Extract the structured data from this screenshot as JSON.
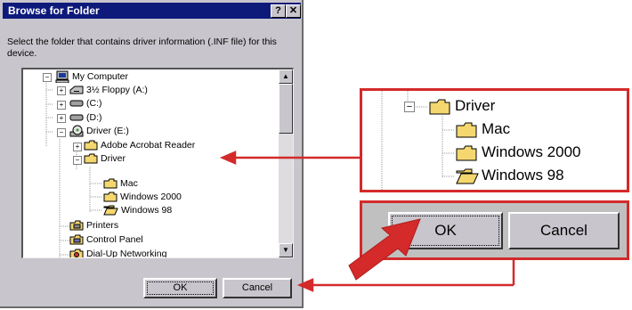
{
  "dialog": {
    "title": "Browse for Folder",
    "help_button": "?",
    "close_button": "✕",
    "instruction": "Select the folder that contains driver information (.INF file) for this device.",
    "tree": [
      {
        "label": "My Computer",
        "icon": "computer-icon",
        "expander": "−"
      },
      {
        "label": "3½ Floppy (A:)",
        "icon": "floppy-drive-icon",
        "expander": "+"
      },
      {
        "label": "(C:)",
        "icon": "hard-drive-icon",
        "expander": "+"
      },
      {
        "label": "(D:)",
        "icon": "hard-drive-icon",
        "expander": "+"
      },
      {
        "label": "Driver (E:)",
        "icon": "cd-drive-icon",
        "expander": "−"
      },
      {
        "label": "Adobe Acrobat Reader",
        "icon": "folder-icon",
        "expander": "+"
      },
      {
        "label": "Driver",
        "icon": "folder-icon",
        "expander": "−"
      },
      {
        "label": "Mac",
        "icon": "folder-icon"
      },
      {
        "label": "Windows 2000",
        "icon": "folder-icon"
      },
      {
        "label": "Windows 98",
        "icon": "open-folder-icon"
      },
      {
        "label": "Printers",
        "icon": "printers-icon"
      },
      {
        "label": "Control Panel",
        "icon": "control-panel-icon"
      },
      {
        "label": "Dial-Up Networking",
        "icon": "dialup-networking-icon"
      }
    ],
    "ok_label": "OK",
    "cancel_label": "Cancel",
    "scroll_up": "▲",
    "scroll_down": "▼"
  },
  "zoom": {
    "tree": [
      {
        "label": "Driver",
        "icon": "folder-icon",
        "expander": "−"
      },
      {
        "label": "Mac",
        "icon": "folder-icon"
      },
      {
        "label": "Windows 2000",
        "icon": "folder-icon"
      },
      {
        "label": "Windows 98",
        "icon": "open-folder-icon"
      }
    ],
    "ok_label": "OK",
    "cancel_label": "Cancel"
  },
  "colors": {
    "callout_red": "#d42a2a",
    "titlebar_blue": "#0e1a7a",
    "folder_yellow": "#f5d770",
    "dialog_gray": "#c8c6cc"
  }
}
